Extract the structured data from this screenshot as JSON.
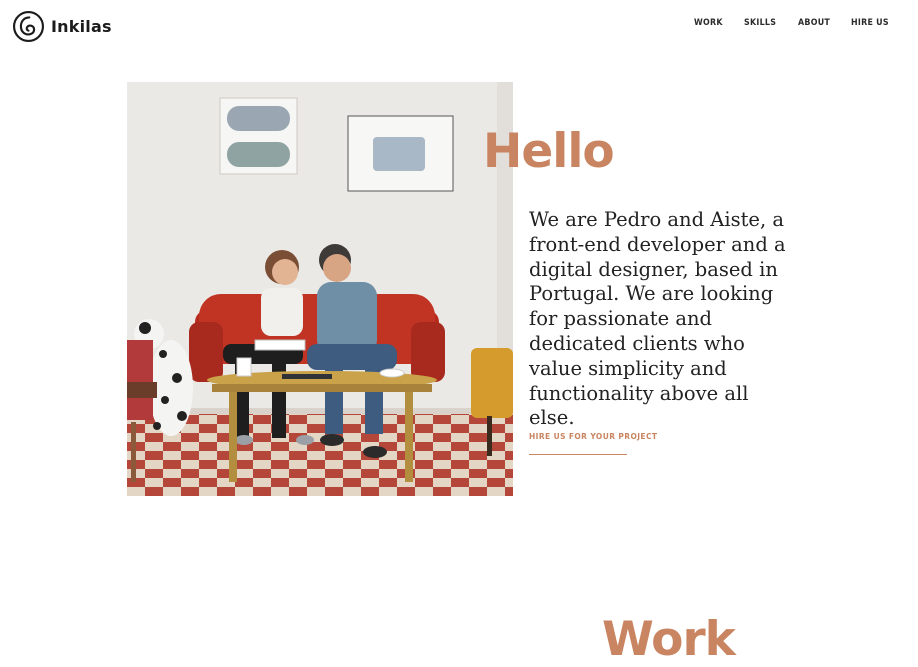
{
  "brand": {
    "name": "Inkilas",
    "icon": "spiral-logo-icon"
  },
  "nav": {
    "items": [
      "WORK",
      "SKILLS",
      "ABOUT",
      "HIRE US"
    ]
  },
  "hero": {
    "heading": "Hello",
    "intro": "We are Pedro and Aiste, a front-end developer and a digital designer, based in Portugal. We are looking for passionate and dedicated clients who value simplicity and functionality above all else.",
    "cta": "HIRE US FOR YOUR PROJECT"
  },
  "work": {
    "heading": "Work"
  },
  "colors": {
    "accent": "#c98561",
    "text": "#222222",
    "background": "#ffffff"
  }
}
